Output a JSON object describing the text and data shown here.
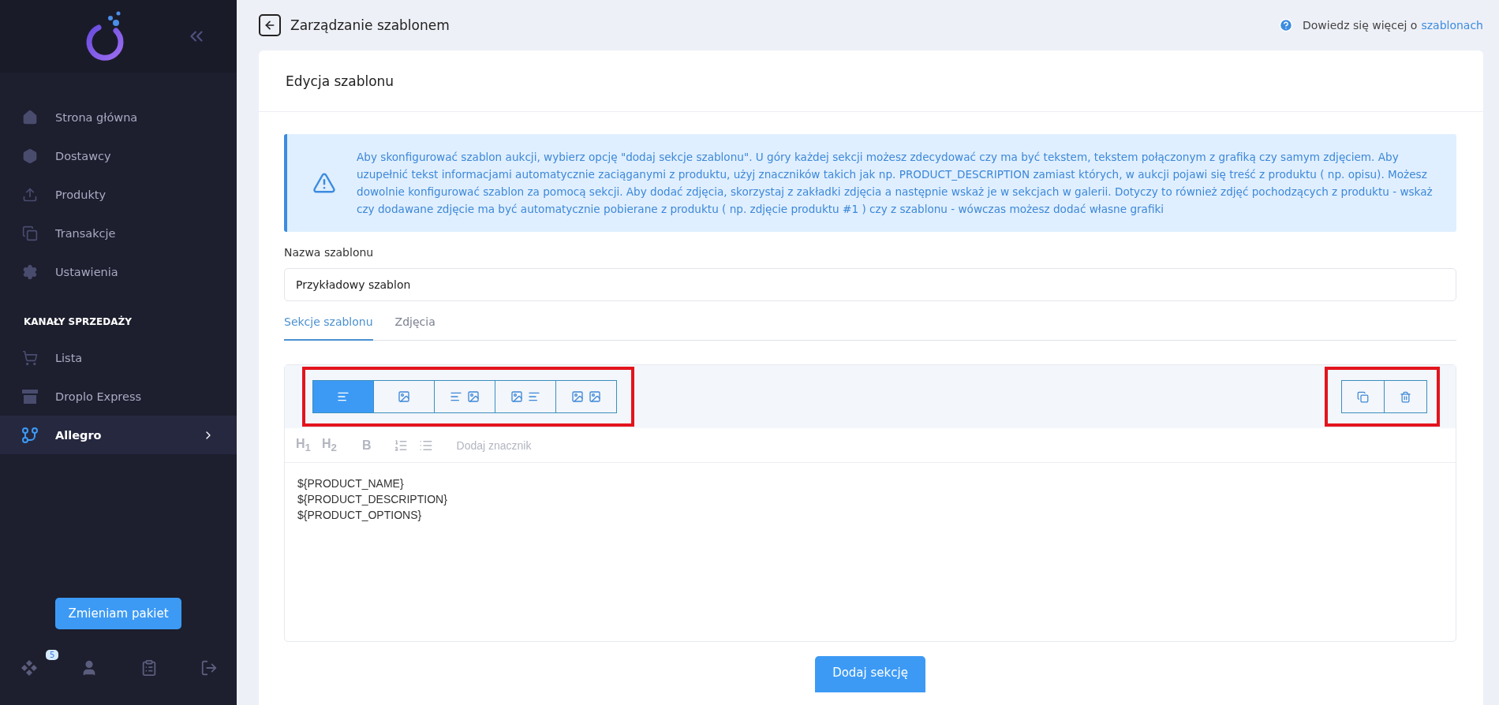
{
  "sidebar": {
    "nav": [
      {
        "label": "Strona główna",
        "selected": false
      },
      {
        "label": "Dostawcy",
        "selected": false
      },
      {
        "label": "Produkty",
        "selected": false
      },
      {
        "label": "Transakcje",
        "selected": false
      },
      {
        "label": "Ustawienia",
        "selected": false
      }
    ],
    "section_title": "KANAŁY SPRZEDAŻY",
    "channels": [
      {
        "label": "Lista",
        "selected": false,
        "expandable": false
      },
      {
        "label": "Droplo Express",
        "selected": false,
        "expandable": false
      },
      {
        "label": "Allegro",
        "selected": true,
        "expandable": true
      }
    ],
    "plan_button": "Zmieniam pakiet",
    "footer": {
      "badge": "5"
    }
  },
  "header": {
    "title": "Zarządzanie szablonem",
    "help_text": "Dowiedz się więcej o",
    "help_link": "szablonach"
  },
  "card": {
    "title": "Edycja szablonu",
    "info": "Aby skonfigurować szablon aukcji, wybierz opcję \"dodaj sekcje szablonu\". U góry każdej sekcji możesz zdecydować czy ma być tekstem, tekstem połączonym z grafiką czy samym zdjęciem. Aby uzupełnić tekst informacjami automatycznie zaciąganymi z produktu, użyj znaczników takich jak np. PRODUCT_DESCRIPTION zamiast których, w aukcji pojawi się treść z produktu ( np. opisu). Możesz dowolnie konfigurować szablon za pomocą sekcji. Aby dodać zdjęcia, skorzystaj z zakładki zdjęcia a następnie wskaż je w sekcjach w galerii. Dotyczy to również zdjęć pochodzących z produktu - wskaż czy dodawane zdjęcie ma być automatycznie pobierane z produktu ( np. zdjęcie produktu #1 ) czy z szablonu - wówczas możesz dodać własne grafiki",
    "name_label": "Nazwa szablonu",
    "name_value": "Przykładowy szablon",
    "tabs": [
      {
        "label": "Sekcje szablonu",
        "selected": true
      },
      {
        "label": "Zdjęcia",
        "selected": false
      }
    ],
    "section": {
      "layouts": [
        {
          "kind": "text",
          "selected": true
        },
        {
          "kind": "image",
          "selected": false
        },
        {
          "kind": "text-image",
          "selected": false
        },
        {
          "kind": "image-text",
          "selected": false
        },
        {
          "kind": "image-image",
          "selected": false
        }
      ],
      "toolbar": {
        "headings": [
          "H$_{1}$",
          "H$_{2}$"
        ],
        "bold": "B",
        "insert_tag": "Dodaj znacznik"
      },
      "content": [
        "${PRODUCT_NAME}",
        "${PRODUCT_DESCRIPTION}",
        "${PRODUCT_OPTIONS}"
      ]
    },
    "add_button": "Dodaj sekcję"
  }
}
